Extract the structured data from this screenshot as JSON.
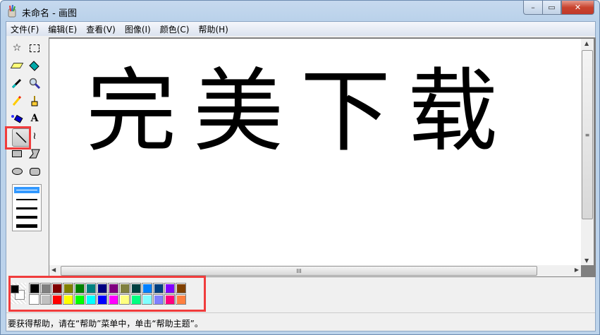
{
  "window": {
    "title": "未命名 - 画图",
    "minimize": "–",
    "maximize": "▭",
    "close": "✕"
  },
  "menu": [
    "文件(F)",
    "编辑(E)",
    "查看(V)",
    "图像(I)",
    "颜色(C)",
    "帮助(H)"
  ],
  "tools": [
    "free-select",
    "rect-select",
    "eraser",
    "fill",
    "color-picker",
    "magnifier",
    "pencil",
    "brush",
    "airbrush",
    "text",
    "line",
    "curve",
    "rectangle",
    "polygon",
    "ellipse",
    "rounded-rectangle"
  ],
  "selected_tool": "line",
  "line_widths": [
    1,
    2,
    3,
    4,
    5
  ],
  "canvas_drawing_text": "完美下载",
  "colors": {
    "foreground": "#000000",
    "background": "#FFFFFF",
    "highlight": "#F03C3C",
    "palette_top": [
      "#000000",
      "#808080",
      "#800000",
      "#808000",
      "#008000",
      "#008080",
      "#000080",
      "#800080",
      "#808040",
      "#004040",
      "#0080FF",
      "#004080",
      "#8000FF",
      "#804000"
    ],
    "palette_bottom": [
      "#FFFFFF",
      "#C0C0C0",
      "#FF0000",
      "#FFFF00",
      "#00FF00",
      "#00FFFF",
      "#0000FF",
      "#FF00FF",
      "#FFFF80",
      "#00FF80",
      "#80FFFF",
      "#8080FF",
      "#FF0080",
      "#FF8040"
    ]
  },
  "status": {
    "text": "要获得帮助，请在“帮助”菜单中，单击“帮助主题”。"
  },
  "scroll": {
    "thumb_grip": "III"
  }
}
